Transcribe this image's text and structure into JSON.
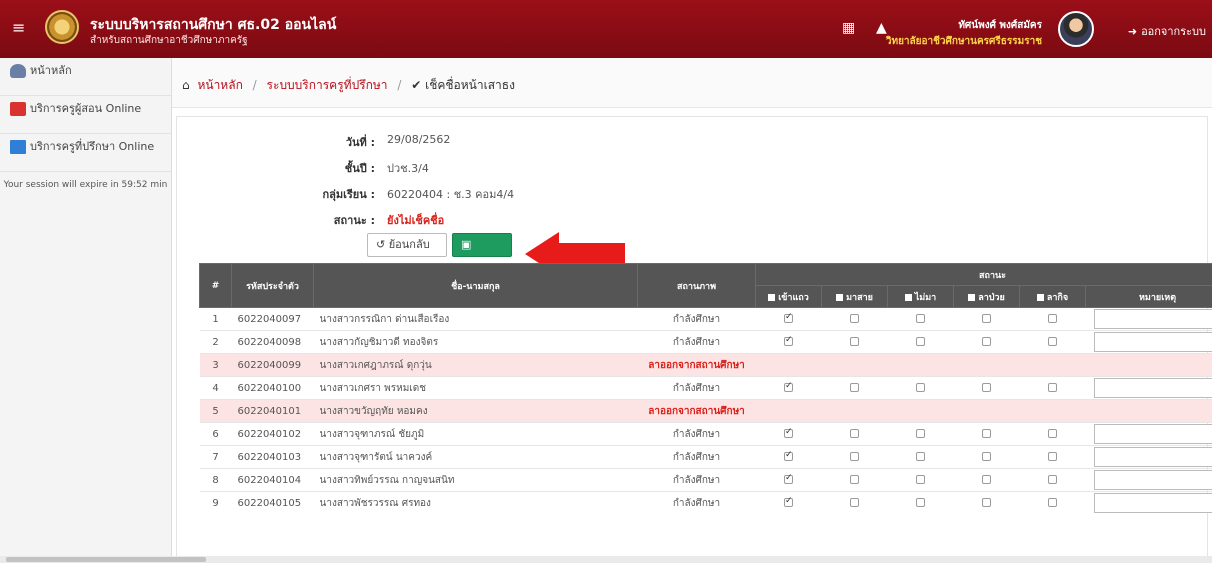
{
  "header": {
    "title": "ระบบบริหารสถานศึกษา ศธ.02 ออนไลน์",
    "subtitle": "สำหรับสถานศึกษาอาชีวศึกษาภาครัฐ",
    "user_name": "ทัศน์พงศ์ พงศ์สมัคร",
    "user_school": "วิทยาลัยอาชีวศึกษานครศรีธรรมราช",
    "logout_label": "ออกจากระบบ",
    "colors": {
      "bar": "#8b0d15",
      "school_text": "#ffd54a"
    }
  },
  "sidebar": {
    "items": [
      {
        "label": "หน้าหลัก",
        "icon": "home-icon"
      },
      {
        "label": "บริการครูผู้สอน Online",
        "icon": "teacher-icon"
      },
      {
        "label": "บริการครูที่ปรึกษา Online",
        "icon": "monitor-icon"
      }
    ],
    "session_text": "Your session will expire in 59:52 min"
  },
  "breadcrumb": {
    "home": "หน้าหลัก",
    "section": "ระบบบริการครูที่ปรึกษา",
    "current": "เช็คชื่อหน้าเสาธง"
  },
  "form": {
    "date_label": "วันที่ :",
    "date_value": "29/08/2562",
    "level_label": "ชั้นปี :",
    "level_value": "ปวช.3/4",
    "group_label": "กลุ่มเรียน :",
    "group_value": "60220404 : ช.3 คอม4/4",
    "status_label": "สถานะ :",
    "status_value": "ยังไม่เช็คชื่อ",
    "back_label": "ย้อนกลับ",
    "save_label": "บันทึก"
  },
  "table": {
    "headers": {
      "num": "#",
      "id": "รหัสประจำตัว",
      "name": "ชื่อ-นามสกุล",
      "state": "สถานภาพ",
      "status_group": "สถานะ",
      "present": "เข้าแถว",
      "late": "มาสาย",
      "absent": "ไม่มา",
      "sick": "ลาป่วย",
      "leave": "ลากิจ",
      "note": "หมายเหตุ"
    },
    "rows": [
      {
        "num": "1",
        "id": "6022040097",
        "name": "นางสาวกรรณิกา ด่านเสือเรือง",
        "state": "กำลังศึกษา",
        "left": false,
        "present": true
      },
      {
        "num": "2",
        "id": "6022040098",
        "name": "นางสาวกัญชิมาวดี ทองจิตร",
        "state": "กำลังศึกษา",
        "left": false,
        "present": true
      },
      {
        "num": "3",
        "id": "6022040099",
        "name": "นางสาวเกศฎาภรณ์ ดุกวุ่น",
        "state": "ลาออกจากสถานศึกษา",
        "left": true,
        "present": false
      },
      {
        "num": "4",
        "id": "6022040100",
        "name": "นางสาวเกศรา พรหมเดช",
        "state": "กำลังศึกษา",
        "left": false,
        "present": true
      },
      {
        "num": "5",
        "id": "6022040101",
        "name": "นางสาวขวัญฤทัย หอมคง",
        "state": "ลาออกจากสถานศึกษา",
        "left": true,
        "present": false
      },
      {
        "num": "6",
        "id": "6022040102",
        "name": "นางสาวจุฑาภรณ์ ชัยภูมิ",
        "state": "กำลังศึกษา",
        "left": false,
        "present": true
      },
      {
        "num": "7",
        "id": "6022040103",
        "name": "นางสาวจุฑารัตน์ นาควงค์",
        "state": "กำลังศึกษา",
        "left": false,
        "present": true
      },
      {
        "num": "8",
        "id": "6022040104",
        "name": "นางสาวทิพย์วรรณ กาญจนสนิท",
        "state": "กำลังศึกษา",
        "left": false,
        "present": true
      },
      {
        "num": "9",
        "id": "6022040105",
        "name": "นางสาวพัชรวรรณ ศรทอง",
        "state": "กำลังศึกษา",
        "left": false,
        "present": true
      }
    ]
  }
}
